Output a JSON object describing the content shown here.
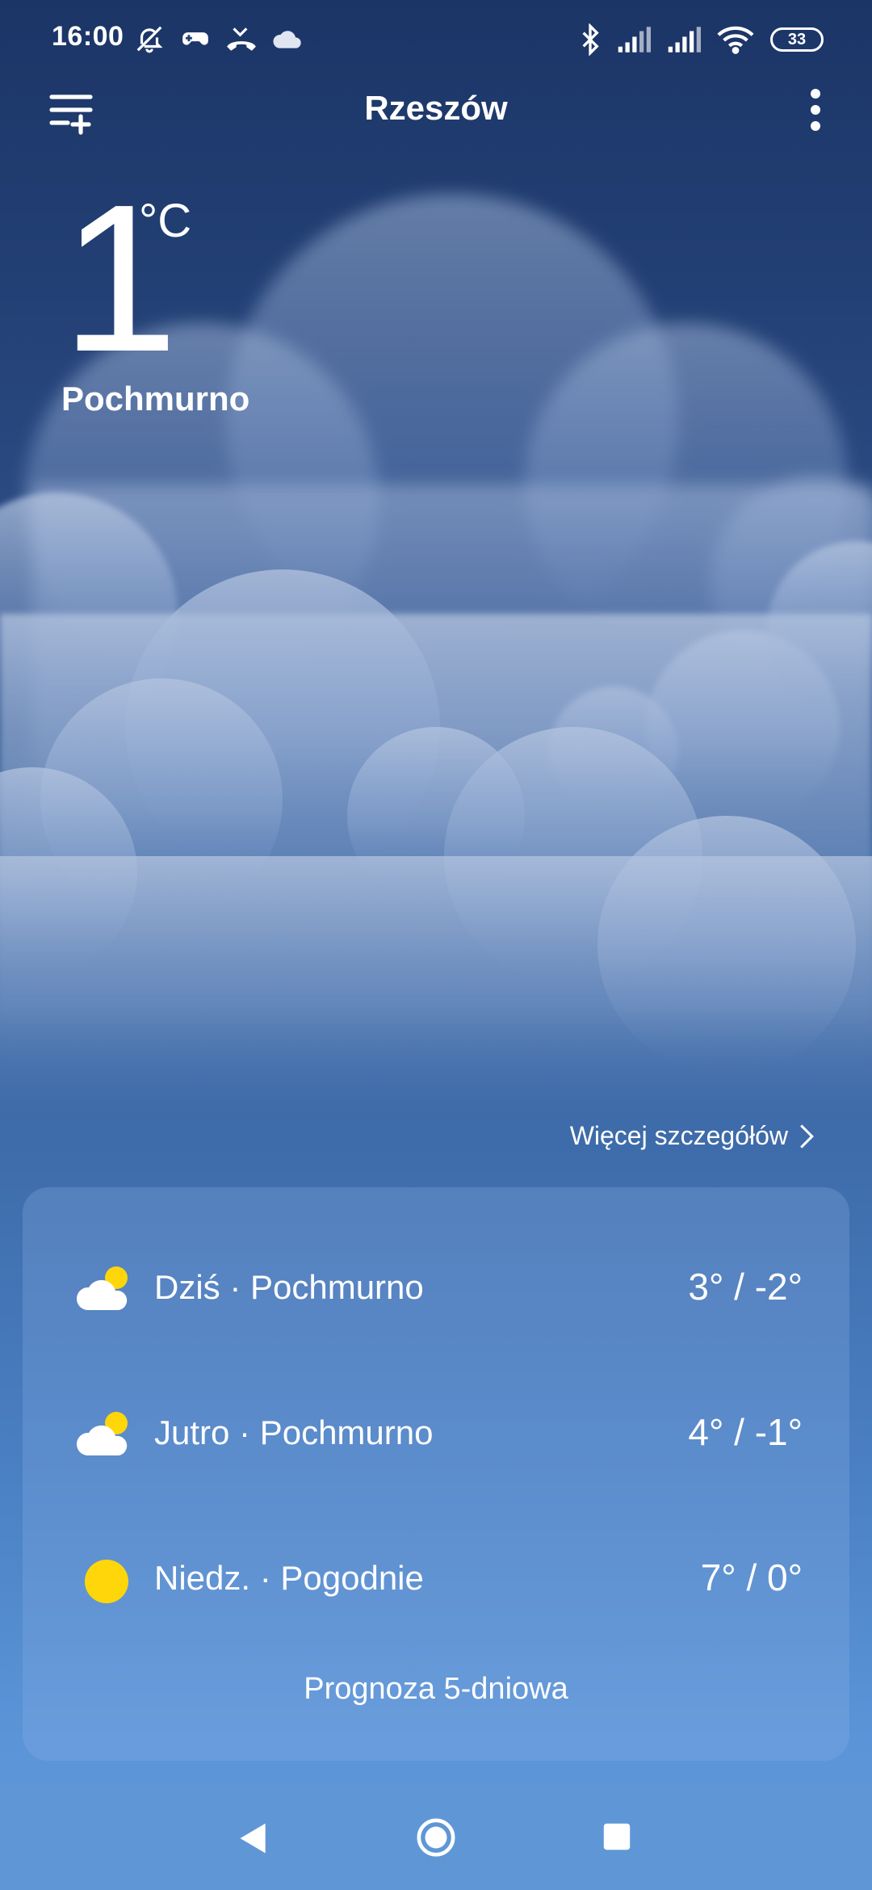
{
  "status_bar": {
    "time": "16:00",
    "battery": "33",
    "icons_left": [
      "mute-icon",
      "game-icon",
      "missed-call-icon",
      "cloud-icon"
    ],
    "icons_right": [
      "bluetooth-icon",
      "signal-icon",
      "signal-icon",
      "wifi-icon",
      "battery-icon"
    ]
  },
  "header": {
    "city": "Rzeszów"
  },
  "current": {
    "temperature": "1",
    "unit": "°C",
    "condition": "Pochmurno"
  },
  "details_link": "Więcej szczegółów",
  "forecast": {
    "rows": [
      {
        "label": "Dziś · Pochmurno",
        "temps": "3° / -2°",
        "icon": "cloud-sun-icon"
      },
      {
        "label": "Jutro · Pochmurno",
        "temps": "4° / -1°",
        "icon": "cloud-sun-icon"
      },
      {
        "label": "Niedz. · Pogodnie",
        "temps": "7° / 0°",
        "icon": "sun-icon"
      }
    ],
    "five_day_label": "Prognoza 5-dniowa"
  },
  "colors": {
    "sun": "#ffd60a",
    "background_top": "#1c3567",
    "background_bottom": "#5f97d6"
  }
}
